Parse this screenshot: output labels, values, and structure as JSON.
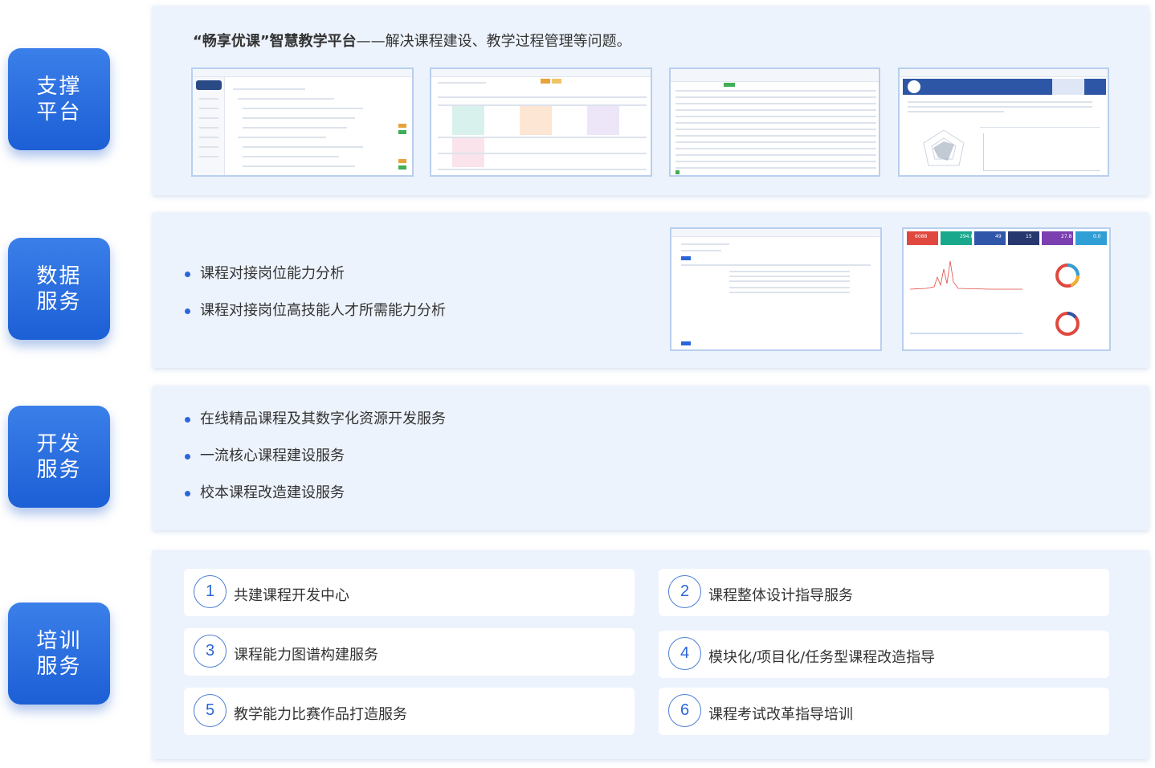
{
  "sections": {
    "support": {
      "tag_line1": "支撑",
      "tag_line2": "平台",
      "intro_bold": "“畅享优课”智慧教学平台",
      "intro_rest": "——解决课程建设、教学过程管理等问题。"
    },
    "data": {
      "tag_line1": "数据",
      "tag_line2": "服务",
      "bullets": [
        "课程对接岗位能力分析",
        "课程对接岗位高技能人才所需能力分析"
      ]
    },
    "dev": {
      "tag_line1": "开发",
      "tag_line2": "服务",
      "bullets": [
        "在线精品课程及其数字化资源开发服务",
        "一流核心课程建设服务",
        "校本课程改造建设服务"
      ]
    },
    "training": {
      "tag_line1": "培训",
      "tag_line2": "服务",
      "items": [
        {
          "num": "1",
          "label": "共建课程开发中心"
        },
        {
          "num": "2",
          "label": "课程整体设计指导服务"
        },
        {
          "num": "3",
          "label": "课程能力图谱构建服务"
        },
        {
          "num": "4",
          "label": "模块化/项目化/任务型课程改造指导"
        },
        {
          "num": "5",
          "label": "教学能力比赛作品打造服务"
        },
        {
          "num": "6",
          "label": "课程考试改革指导培训"
        }
      ]
    }
  },
  "dashboard_stats": [
    "6088",
    "294.80",
    "49",
    "15",
    "27.8",
    "0.0"
  ],
  "colors": {
    "tag_blue": "#1c5fd6",
    "panel_bg": "#edf3fc",
    "bullet_dot": "#2b66d9",
    "stat_tiles": [
      "#e0483f",
      "#19a88c",
      "#2f56a8",
      "#26386d",
      "#7b3fb0",
      "#2f9fd6"
    ]
  }
}
